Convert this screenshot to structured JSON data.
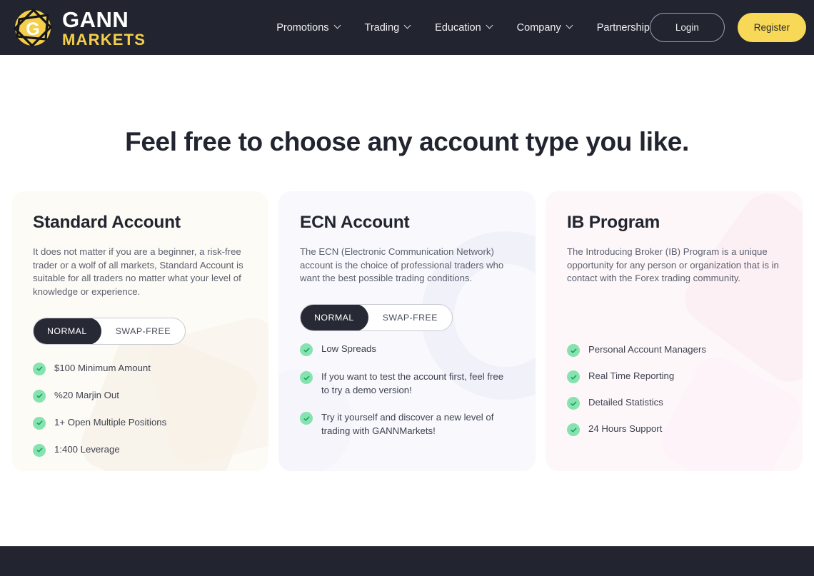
{
  "header": {
    "logo": {
      "icon": "gann-logo-icon",
      "primary_text": "GANN",
      "secondary_text": "MARKETS"
    },
    "nav": [
      {
        "label": "Promotions",
        "has_dropdown": true
      },
      {
        "label": "Trading",
        "has_dropdown": true
      },
      {
        "label": "Education",
        "has_dropdown": true
      },
      {
        "label": "Company",
        "has_dropdown": true
      },
      {
        "label": "Partnership",
        "has_dropdown": false
      }
    ],
    "login_label": "Login",
    "register_label": "Register"
  },
  "main": {
    "heading": "Feel free to choose any account type you like.",
    "cards": [
      {
        "title": "Standard Account",
        "description": "It does not matter if you are a beginner, a risk-free trader or a wolf of all markets, Standard Account is suitable for all traders no matter what your level of knowledge or experience.",
        "toggle": {
          "options": [
            "NORMAL",
            "SWAP-FREE"
          ],
          "selected": "NORMAL"
        },
        "features": [
          "$100 Minimum Amount",
          "%20 Marjin Out",
          "1+ Open Multiple Positions",
          "1:400 Leverage"
        ]
      },
      {
        "title": "ECN Account",
        "description": "The ECN (Electronic Communication Network) account is the choice of professional traders who want the best possible trading conditions.",
        "toggle": {
          "options": [
            "NORMAL",
            "SWAP-FREE"
          ],
          "selected": "NORMAL"
        },
        "features": [
          "Low Spreads",
          "If you want to test the account first, feel free to try a demo version!",
          "Try it yourself and discover a new level of trading with GANNMarkets!"
        ]
      },
      {
        "title": "IB Program",
        "description": "The Introducing Broker (IB) Program is a unique opportunity for any person or organization that is in contact with the Forex trading community.",
        "toggle": null,
        "features": [
          "Personal Account Managers",
          "Real Time Reporting",
          "Detailed Statistics",
          "24 Hours Support"
        ]
      }
    ]
  },
  "colors": {
    "header_bg": "#22252f",
    "brand_yellow": "#f7d857",
    "card_cream": "#fdfbf6",
    "card_lilac": "#f8f8fd",
    "card_blush": "#fdf7fa",
    "check_green": "#86e3b0",
    "toggle_active": "#272a35"
  }
}
